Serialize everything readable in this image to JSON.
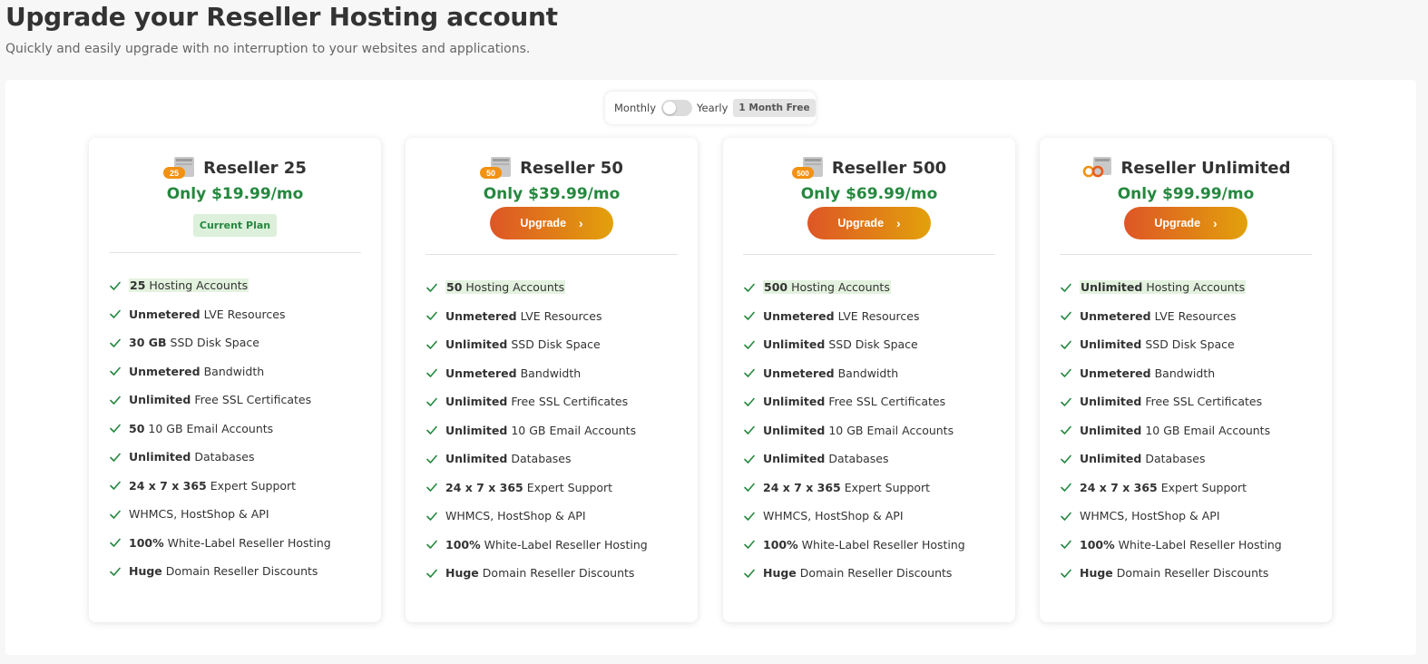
{
  "header": {
    "title": "Upgrade your Reseller Hosting account",
    "subtitle": "Quickly and easily upgrade with no interruption to your websites and applications."
  },
  "billing_toggle": {
    "monthly_label": "Monthly",
    "yearly_label": "Yearly",
    "badge": "1 Month Free",
    "selected": "Monthly"
  },
  "colors": {
    "accent_green": "#25883f",
    "button_gradient_start": "#de5626",
    "button_gradient_end": "#e2a10b"
  },
  "plans": [
    {
      "icon_label": "25",
      "name": "Reseller 25",
      "price": "Only $19.99/mo",
      "action": "Current Plan",
      "features": [
        {
          "bold": "25",
          "text": "Hosting Accounts"
        },
        {
          "bold": "Unmetered",
          "text": "LVE Resources"
        },
        {
          "bold": "30 GB",
          "text": "SSD Disk Space"
        },
        {
          "bold": "Unmetered",
          "text": "Bandwidth"
        },
        {
          "bold": "Unlimited",
          "text": "Free SSL Certificates"
        },
        {
          "bold": "50",
          "text": "10 GB Email Accounts"
        },
        {
          "bold": "Unlimited",
          "text": "Databases"
        },
        {
          "bold": "24 x 7 x 365",
          "text": "Expert Support"
        },
        {
          "bold": "",
          "text": "WHMCS, HostShop & API"
        },
        {
          "bold": "100%",
          "text": "White-Label Reseller Hosting"
        },
        {
          "bold": "Huge",
          "text": "Domain Reseller Discounts"
        }
      ]
    },
    {
      "icon_label": "50",
      "name": "Reseller 50",
      "price": "Only $39.99/mo",
      "action": "Upgrade",
      "features": [
        {
          "bold": "50",
          "text": "Hosting Accounts"
        },
        {
          "bold": "Unmetered",
          "text": "LVE Resources"
        },
        {
          "bold": "Unlimited",
          "text": "SSD Disk Space"
        },
        {
          "bold": "Unmetered",
          "text": "Bandwidth"
        },
        {
          "bold": "Unlimited",
          "text": "Free SSL Certificates"
        },
        {
          "bold": "Unlimited",
          "text": "10 GB Email Accounts"
        },
        {
          "bold": "Unlimited",
          "text": "Databases"
        },
        {
          "bold": "24 x 7 x 365",
          "text": "Expert Support"
        },
        {
          "bold": "",
          "text": "WHMCS, HostShop & API"
        },
        {
          "bold": "100%",
          "text": "White-Label Reseller Hosting"
        },
        {
          "bold": "Huge",
          "text": "Domain Reseller Discounts"
        }
      ]
    },
    {
      "icon_label": "500",
      "name": "Reseller 500",
      "price": "Only $69.99/mo",
      "action": "Upgrade",
      "features": [
        {
          "bold": "500",
          "text": "Hosting Accounts"
        },
        {
          "bold": "Unmetered",
          "text": "LVE Resources"
        },
        {
          "bold": "Unlimited",
          "text": "SSD Disk Space"
        },
        {
          "bold": "Unmetered",
          "text": "Bandwidth"
        },
        {
          "bold": "Unlimited",
          "text": "Free SSL Certificates"
        },
        {
          "bold": "Unlimited",
          "text": "10 GB Email Accounts"
        },
        {
          "bold": "Unlimited",
          "text": "Databases"
        },
        {
          "bold": "24 x 7 x 365",
          "text": "Expert Support"
        },
        {
          "bold": "",
          "text": "WHMCS, HostShop & API"
        },
        {
          "bold": "100%",
          "text": "White-Label Reseller Hosting"
        },
        {
          "bold": "Huge",
          "text": "Domain Reseller Discounts"
        }
      ]
    },
    {
      "icon_label": "infinity",
      "name": "Reseller Unlimited",
      "price": "Only $99.99/mo",
      "action": "Upgrade",
      "features": [
        {
          "bold": "Unlimited",
          "text": "Hosting Accounts"
        },
        {
          "bold": "Unmetered",
          "text": "LVE Resources"
        },
        {
          "bold": "Unlimited",
          "text": "SSD Disk Space"
        },
        {
          "bold": "Unmetered",
          "text": "Bandwidth"
        },
        {
          "bold": "Unlimited",
          "text": "Free SSL Certificates"
        },
        {
          "bold": "Unlimited",
          "text": "10 GB Email Accounts"
        },
        {
          "bold": "Unlimited",
          "text": "Databases"
        },
        {
          "bold": "24 x 7 x 365",
          "text": "Expert Support"
        },
        {
          "bold": "",
          "text": "WHMCS, HostShop & API"
        },
        {
          "bold": "100%",
          "text": "White-Label Reseller Hosting"
        },
        {
          "bold": "Huge",
          "text": "Domain Reseller Discounts"
        }
      ]
    }
  ]
}
